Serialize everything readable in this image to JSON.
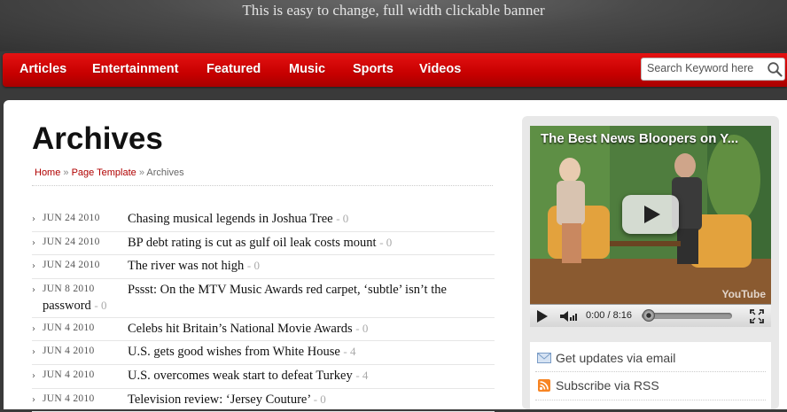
{
  "banner": {
    "text": "This is easy to change, full width clickable banner"
  },
  "nav": {
    "items": [
      "Articles",
      "Entertainment",
      "Featured",
      "Music",
      "Sports",
      "Videos"
    ]
  },
  "search": {
    "placeholder": "Search Keyword here"
  },
  "page": {
    "title": "Archives",
    "breadcrumb": {
      "home": "Home",
      "sep": "»",
      "parent": "Page Template",
      "current": "Archives"
    }
  },
  "archive": [
    {
      "date": "JUN 24 2010",
      "title": "Chasing musical legends in Joshua Tree",
      "comments": "- 0"
    },
    {
      "date": "JUN 24 2010",
      "title": "BP debt rating is cut as gulf oil leak costs mount",
      "comments": "- 0"
    },
    {
      "date": "JUN 24 2010",
      "title": "The river was not high",
      "comments": "- 0"
    },
    {
      "date": "JUN 8 2010",
      "title": "Pssst: On the MTV Music Awards red carpet, ‘subtle’ isn’t the password",
      "comments": "- 0"
    },
    {
      "date": "JUN 4 2010",
      "title": "Celebs hit Britain’s National Movie Awards",
      "comments": "- 0"
    },
    {
      "date": "JUN 4 2010",
      "title": "U.S. gets good wishes from White House",
      "comments": "- 4"
    },
    {
      "date": "JUN 4 2010",
      "title": "U.S. overcomes weak start to defeat Turkey",
      "comments": "- 4"
    },
    {
      "date": "JUN 4 2010",
      "title": "Television review: ‘Jersey Couture’",
      "comments": "- 0"
    }
  ],
  "video": {
    "title": "The Best News Bloopers on Y...",
    "time": "0:00 / 8:16",
    "logo": "YouTube",
    "progress": 0
  },
  "subscribe": {
    "email": "Get updates via email",
    "rss": "Subscribe via RSS"
  },
  "colors": {
    "nav_red": "#d10000",
    "link_red": "#b00000"
  }
}
